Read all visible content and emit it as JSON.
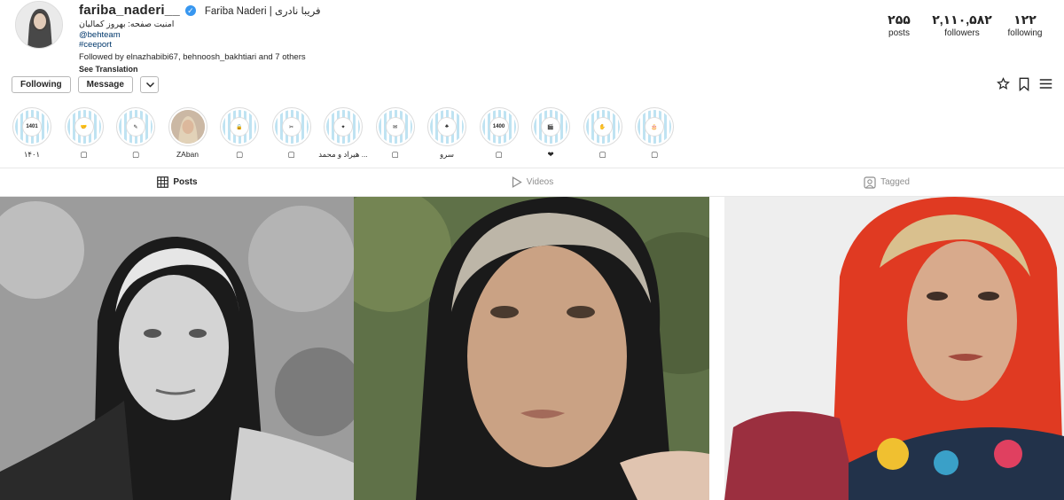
{
  "profile": {
    "username": "fariba_naderi__",
    "full_name": "Fariba Naderi | فریبا نادری",
    "bio_line": "امنیت صفحه: بهروز کمالیان",
    "link_behteam": "@behteam",
    "hashtag": "#ceeport",
    "followed_by": "Followed by elnazhabibi67, behnoosh_bakhtiari and 7 others",
    "see_translation": "See Translation"
  },
  "stats": {
    "posts_count": "۲۵۵",
    "posts_label": "posts",
    "followers_count": "۲,۱۱۰,۵۸۲",
    "followers_label": "followers",
    "following_count": "۱۲۲",
    "following_label": "following"
  },
  "actions": {
    "following_label": "Following",
    "message_label": "Message"
  },
  "highlights": [
    {
      "label": "۱۴۰۱",
      "badge": "1401"
    },
    {
      "label": "▢",
      "badge": "🤝"
    },
    {
      "label": "▢",
      "badge": "✎"
    },
    {
      "label": "ZAban",
      "badge": ""
    },
    {
      "label": "▢",
      "badge": "🔒"
    },
    {
      "label": "▢",
      "badge": "✂"
    },
    {
      "label": "هیراد و محمد ...",
      "badge": "✦"
    },
    {
      "label": "▢",
      "badge": "✉"
    },
    {
      "label": "سرو",
      "badge": "♣"
    },
    {
      "label": "▢",
      "badge": "1400"
    },
    {
      "label": "❤",
      "badge": "🎬"
    },
    {
      "label": "▢",
      "badge": "✋"
    },
    {
      "label": "▢",
      "badge": "🎂"
    }
  ],
  "tabs": {
    "posts": "Posts",
    "videos": "Videos",
    "tagged": "Tagged"
  },
  "colors": {
    "verified_blue": "#3897f0",
    "link_blue": "#00376b",
    "highlight_stripe": "#bfe3f2"
  }
}
